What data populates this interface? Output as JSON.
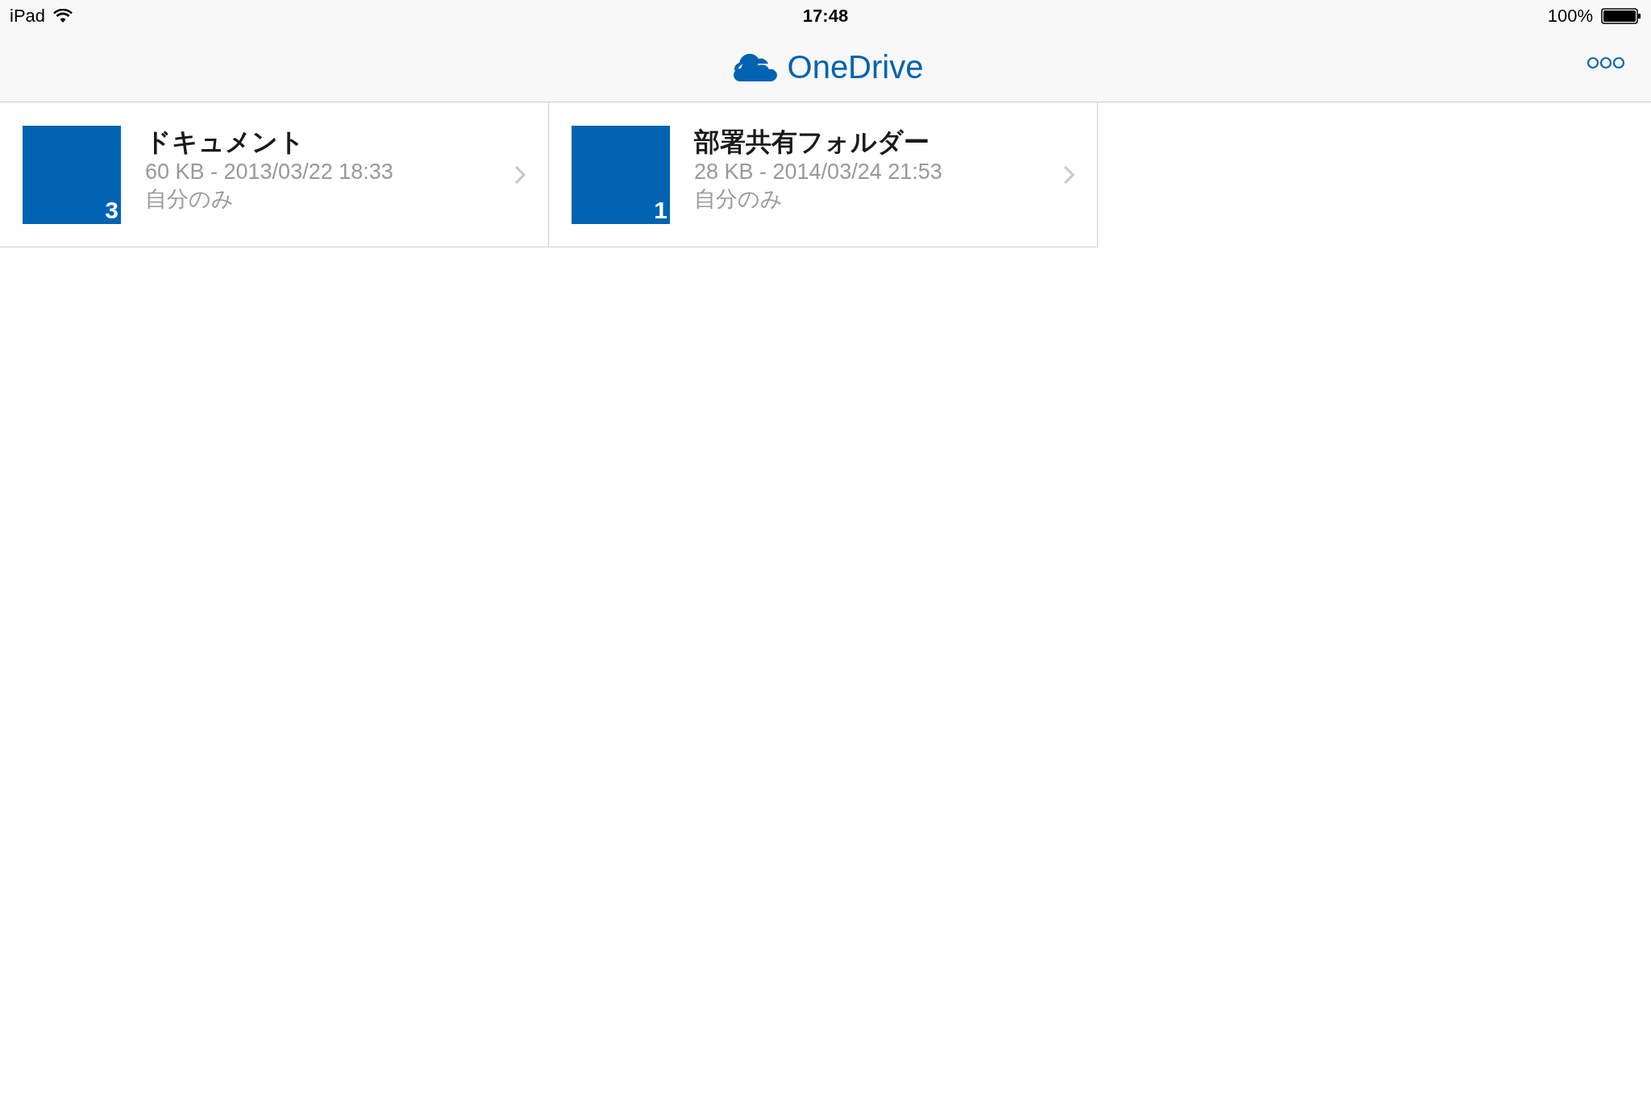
{
  "status_bar": {
    "device": "iPad",
    "time": "17:48",
    "battery": "100%"
  },
  "nav_bar": {
    "title": "OneDrive"
  },
  "folders": [
    {
      "name": "ドキュメント",
      "details": "60 KB - 2013/03/22 18:33",
      "sharing": "自分のみ",
      "count": "3"
    },
    {
      "name": "部署共有フォルダー",
      "details": "28 KB - 2014/03/24 21:53",
      "sharing": "自分のみ",
      "count": "1"
    }
  ]
}
